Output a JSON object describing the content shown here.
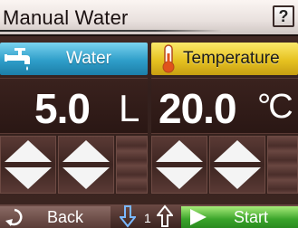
{
  "header": {
    "title": "Manual Water",
    "help_label": "?"
  },
  "water": {
    "label": "Water",
    "icon": "faucet-icon",
    "value": "5.0",
    "unit": "L"
  },
  "temperature": {
    "label": "Temperature",
    "icon": "thermometer-icon",
    "value": "20.0",
    "unit": "°C"
  },
  "footer": {
    "back_label": "Back",
    "page_number": "1",
    "start_label": "Start"
  },
  "colors": {
    "water_header": "#2f9ec9",
    "temperature_header": "#e6c221",
    "start_button": "#3aa42a",
    "background": "#33201d"
  }
}
